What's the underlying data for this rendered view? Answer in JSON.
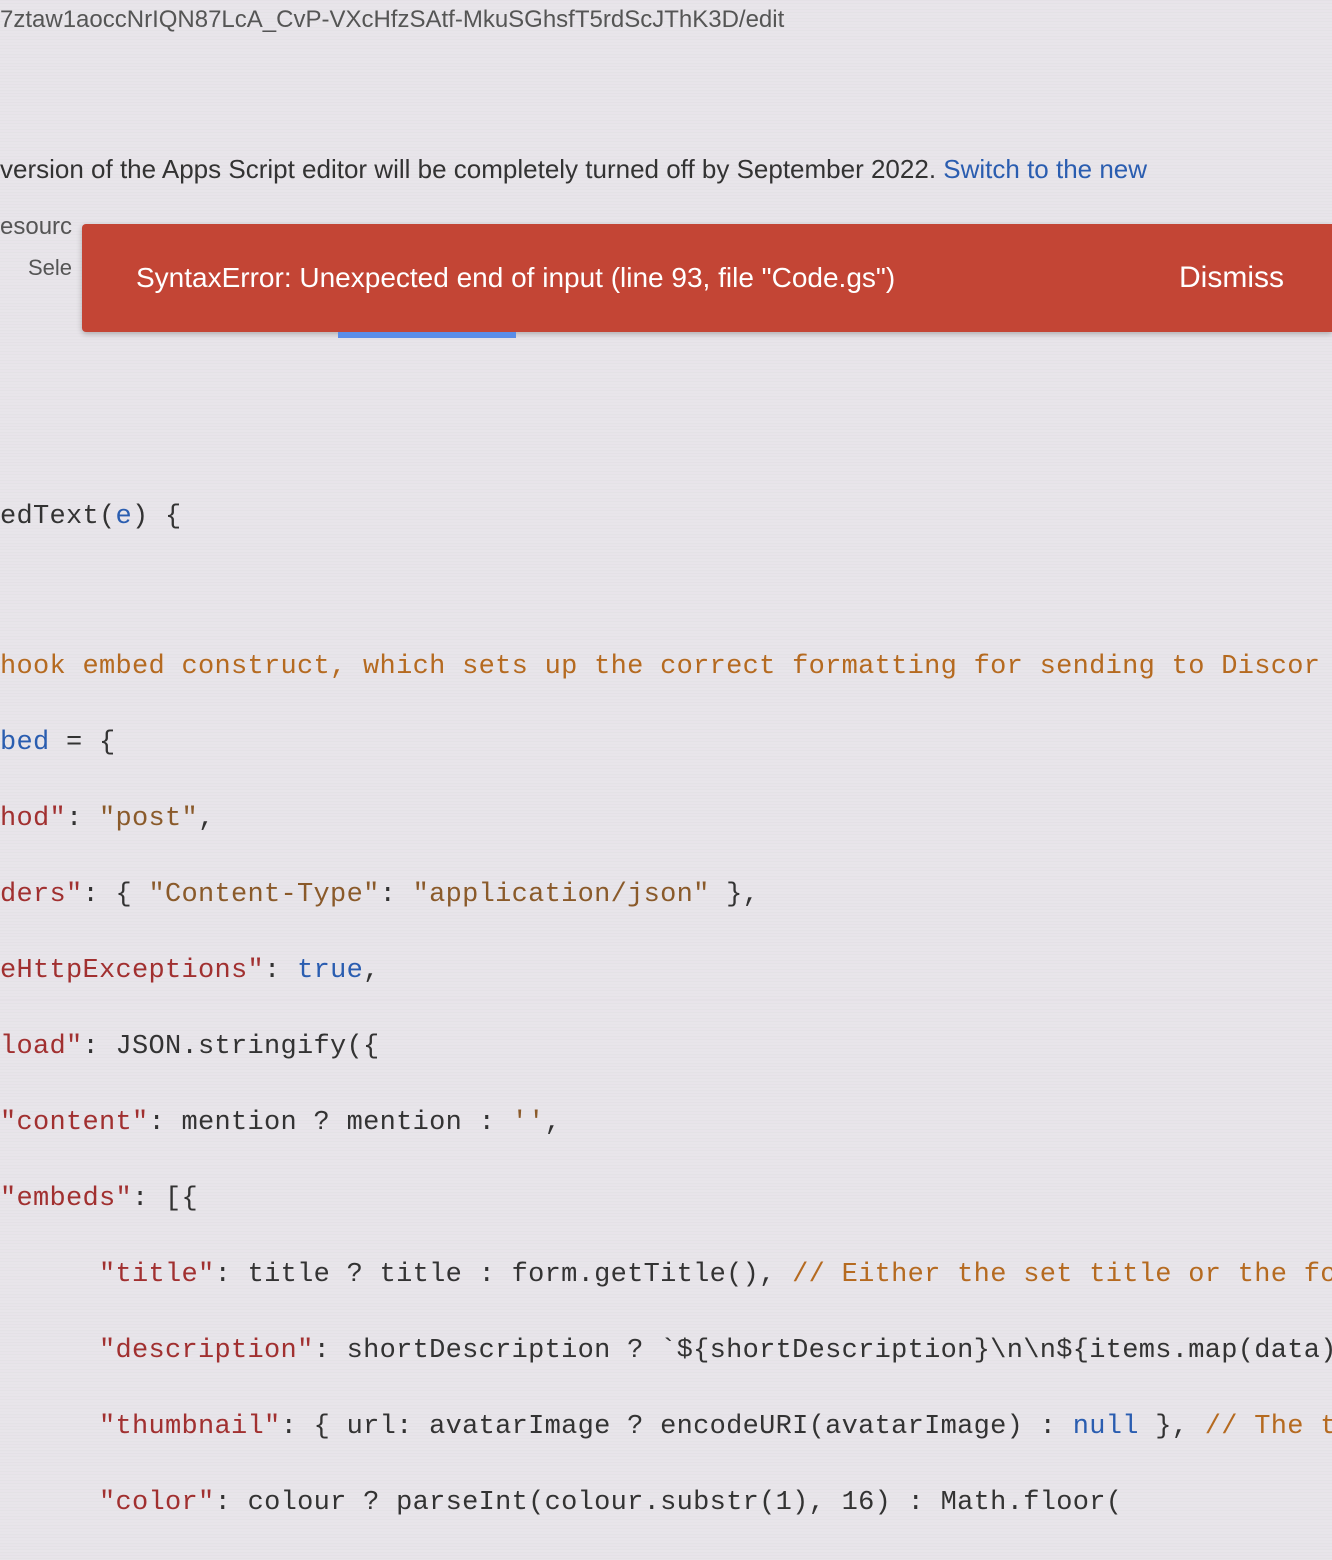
{
  "url": "7ztaw1aoccNrIQN87LcA_CvP-VXcHfzSAtf-MkuSGhsfT5rdScJThK3D/edit",
  "banner": {
    "text_prefix": "version of the Apps Script editor will be completely turned off by September 2022. ",
    "link_text": "Switch to the new"
  },
  "resources_label": "esourc",
  "select_label": "Sele",
  "error": {
    "message": "SyntaxError: Unexpected end of input (line 93, file \"Code.gs\")",
    "dismiss_label": "Dismiss"
  },
  "code": {
    "l1_a": "edText(",
    "l1_b": "e",
    "l1_c": ") {",
    "l2_comment": "hook embed construct, which sets up the correct formatting for sending to Discor",
    "l3_a": "bed",
    "l3_b": " = {",
    "l4_a": "hod\"",
    "l4_b": ": ",
    "l4_c": "\"post\"",
    "l4_d": ",",
    "l5_a": "ders\"",
    "l5_b": ": { ",
    "l5_c": "\"Content-Type\"",
    "l5_d": ": ",
    "l5_e": "\"application/json\"",
    "l5_f": " },",
    "l6_a": "eHttpExceptions\"",
    "l6_b": ": ",
    "l6_c": "true",
    "l6_d": ",",
    "l7_a": "load\"",
    "l7_b": ": JSON.stringify({",
    "l8_a": "\"content\"",
    "l8_b": ": mention ? mention : ",
    "l8_c": "''",
    "l8_d": ",",
    "l9_a": "\"embeds\"",
    "l9_b": ": [{",
    "l10_pad": "      ",
    "l10_a": "\"title\"",
    "l10_b": ": title ? title : form.getTitle(), ",
    "l10_c": "// Either the set title or the form",
    "l11_pad": "      ",
    "l11_a": "\"description\"",
    "l11_b": ": shortDescription ? `${shortDescription}\\n\\n${items.map(data).",
    "l12_pad": "      ",
    "l12_a": "\"thumbnail\"",
    "l12_b": ": { url: avatarImage ? encodeURI(avatarImage) : ",
    "l12_c": "null",
    "l12_d": " }, ",
    "l12_e": "// The ti",
    "l13_pad": "      ",
    "l13_a": "\"color\"",
    "l13_b": ": colour ? parseInt(colour.substr(1), 16) : Math.floor("
  }
}
